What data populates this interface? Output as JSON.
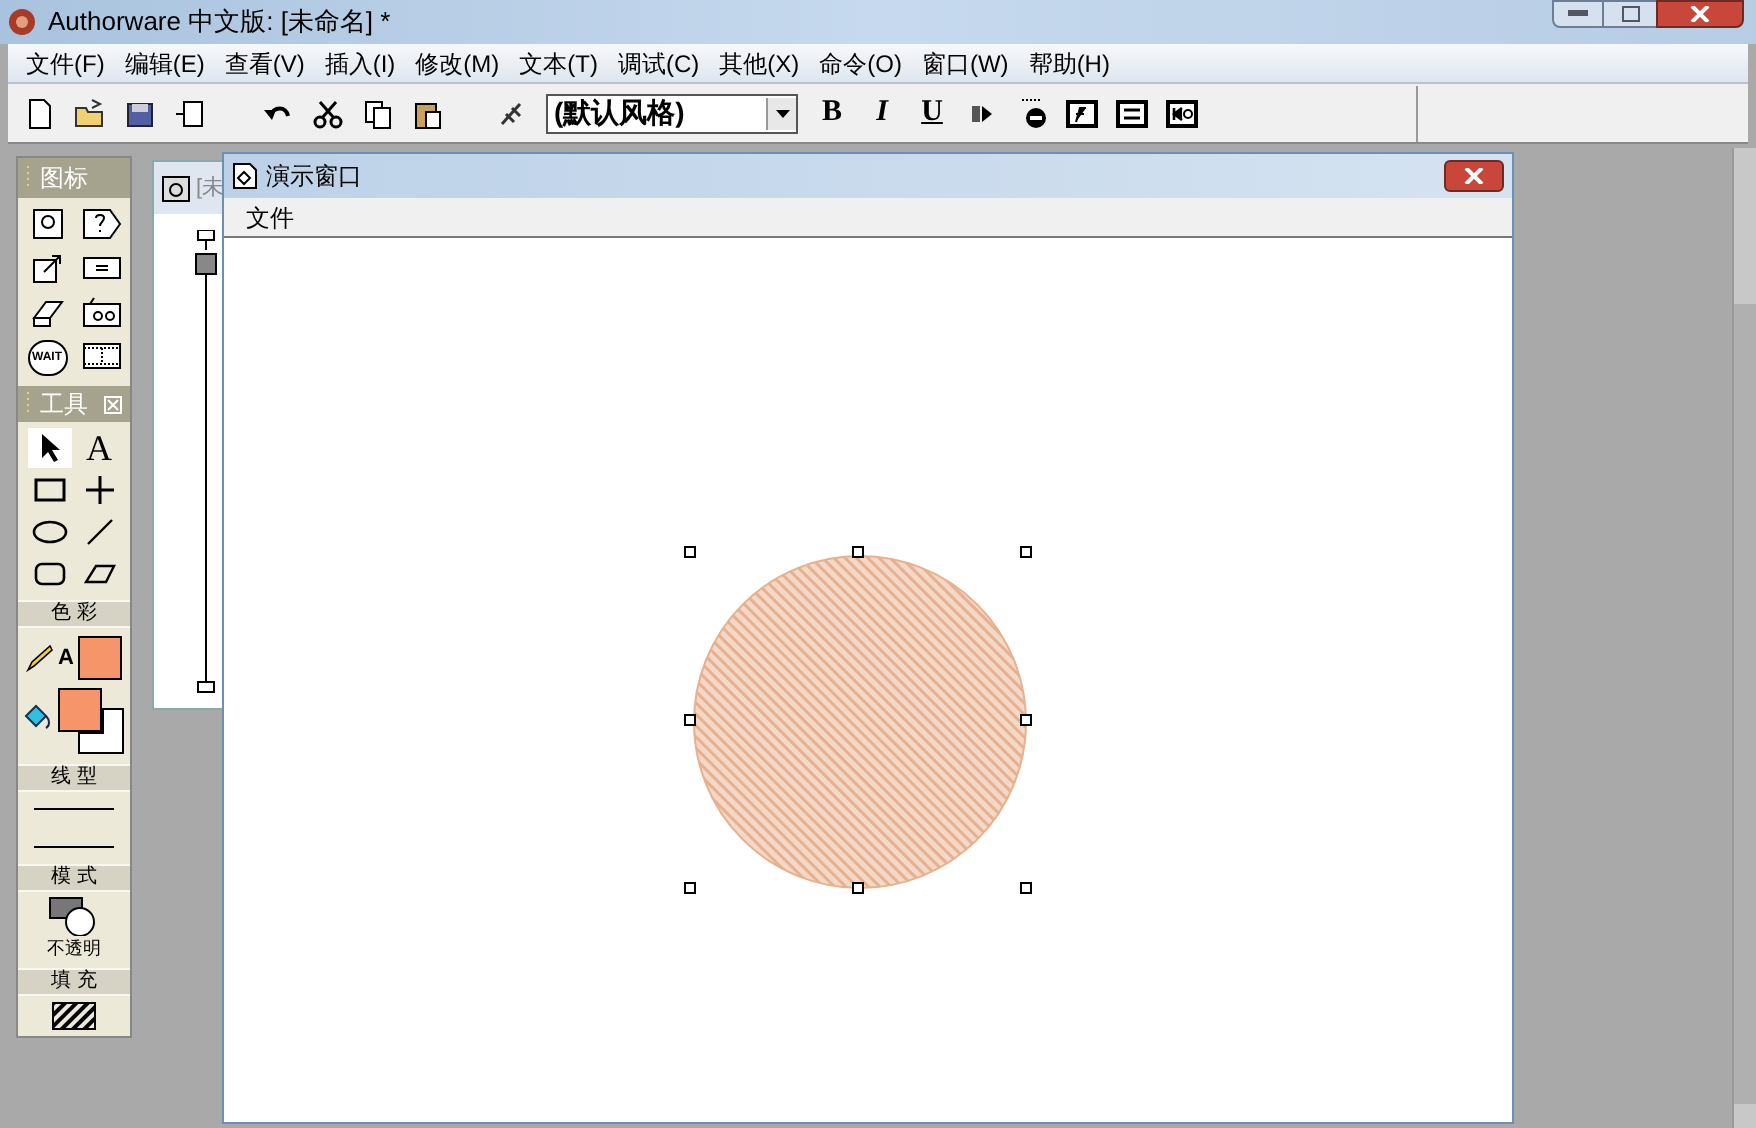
{
  "window": {
    "title": "Authorware 中文版: [未命名] *"
  },
  "menu": [
    "文件(F)",
    "编辑(E)",
    "查看(V)",
    "插入(I)",
    "修改(M)",
    "文本(T)",
    "调试(C)",
    "其他(X)",
    "命令(O)",
    "窗口(W)",
    "帮助(H)"
  ],
  "toolbar": {
    "style_select": {
      "value": "(默认风格)"
    },
    "bold": "B",
    "italic": "I",
    "underline": "U"
  },
  "icon_palette": {
    "title": "图标",
    "wait_label": "WAIT"
  },
  "tools_palette": {
    "title": "工具",
    "tools": [
      {
        "kind": "pointer",
        "selected": true
      },
      {
        "kind": "text",
        "glyph": "A",
        "selected": false
      },
      {
        "kind": "rect",
        "selected": false
      },
      {
        "kind": "cross",
        "selected": false
      },
      {
        "kind": "ellipse",
        "selected": false
      },
      {
        "kind": "line",
        "selected": false
      },
      {
        "kind": "roundrect",
        "selected": false
      },
      {
        "kind": "polygon",
        "selected": false
      }
    ],
    "color_heading": "色 彩",
    "line_color": {
      "glyph": "A",
      "color": "#f6946a"
    },
    "fill_color": {
      "color": "#f6946a"
    },
    "background_color": {
      "color": "#ffffff"
    },
    "line_heading": "线 型",
    "mode_heading": "模 式",
    "mode_label": "不透明",
    "fill_heading": "填 充"
  },
  "flow_window": {
    "title": "[未"
  },
  "presentation_window": {
    "title": "演示窗口",
    "menu": [
      "文件"
    ],
    "circle": {
      "color": "#e7b08e",
      "selected": true
    }
  }
}
